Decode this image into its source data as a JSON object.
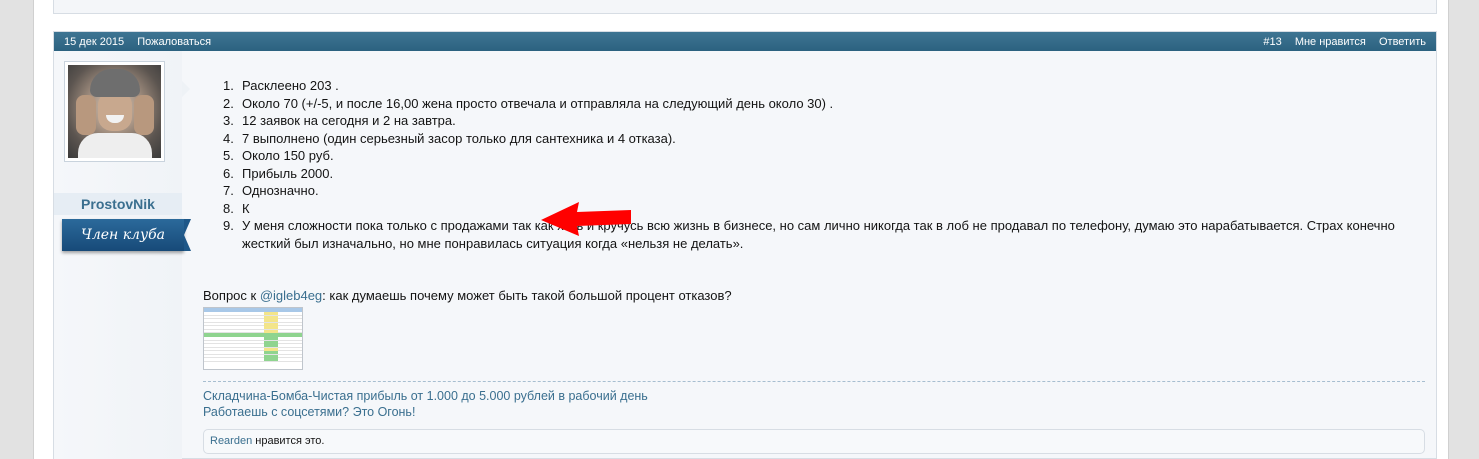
{
  "post": {
    "date": "15 дек 2015",
    "report": "Пожаловаться",
    "number": "#13",
    "like": "Мне нравится",
    "reply": "Ответить"
  },
  "user": {
    "name": "ProstovNik",
    "title": "Член клуба"
  },
  "list": [
    {
      "n": "1.",
      "t": "Расклеено 203 ."
    },
    {
      "n": "2.",
      "t": "Около 70 (+/-5, и после 16,00 жена просто отвечала и отправляла на следующий день около 30) ."
    },
    {
      "n": "3.",
      "t": "12 заявок на сегодня и 2 на завтра."
    },
    {
      "n": "4.",
      "t": "7 выполнено (один серьезный засор только для сантехника и 4 отказа)."
    },
    {
      "n": "5.",
      "t": "Около 150 руб."
    },
    {
      "n": "6.",
      "t": "Прибыль 2000."
    },
    {
      "n": "7.",
      "t": "Однозначно."
    },
    {
      "n": "8.",
      "t": "К"
    },
    {
      "n": "9.",
      "t": "У меня сложности пока только с продажами так как хоть и кручусь всю жизнь в бизнесе, но сам лично никогда так в лоб не продавал по телефону, думаю это нарабатывается. Страх конечно жесткий был изначально, но мне понравилась ситуация когда «нельзя не делать»."
    }
  ],
  "question": {
    "prefix": "Вопрос к ",
    "mention": "@igleb4eg",
    "suffix": ": как думаешь почему может быть такой большой процент отказов?"
  },
  "signature": {
    "line1": "Складчина-Бомба-Чистая прибыль от 1.000 до 5.000 рублей в рабочий день",
    "line2": "Работаешь с соцсетями? Это Огонь!"
  },
  "likes": {
    "who": "Rearden",
    "text": " нравится это."
  },
  "colors": {
    "header": "#2c6280",
    "link": "#3a6f8f",
    "arrow": "#ff0000"
  }
}
